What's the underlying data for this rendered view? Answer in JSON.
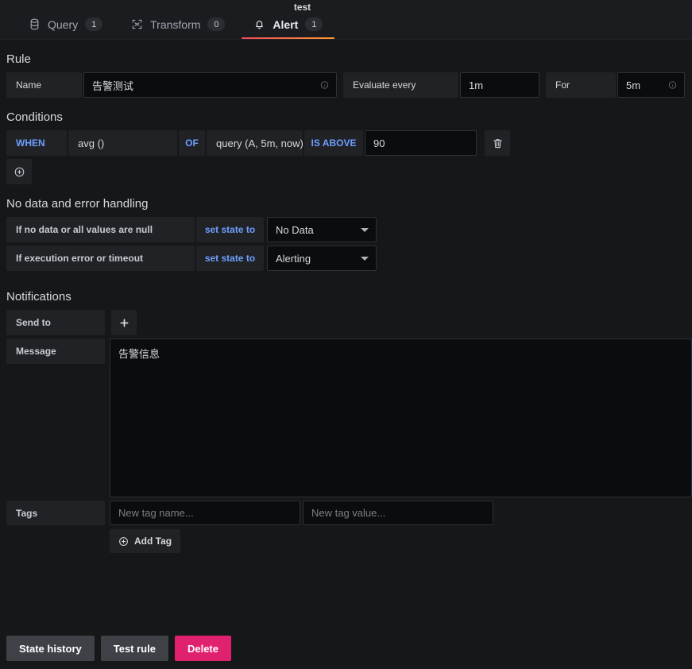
{
  "header": {
    "title": "test",
    "tabs": [
      {
        "label": "Query",
        "badge": "1",
        "icon": "database-icon",
        "active": false
      },
      {
        "label": "Transform",
        "badge": "0",
        "icon": "transform-icon",
        "active": false
      },
      {
        "label": "Alert",
        "badge": "1",
        "icon": "bell-icon",
        "active": true
      }
    ],
    "accent_color": "#ff9830"
  },
  "rule": {
    "section_label": "Rule",
    "name_label": "Name",
    "name_value": "告警测试",
    "evaluate_every_label": "Evaluate every",
    "evaluate_every_value": "1m",
    "for_label": "For",
    "for_value": "5m"
  },
  "conditions": {
    "section_label": "Conditions",
    "rows": [
      {
        "when_label": "WHEN",
        "reducer": "avg ()",
        "of_label": "OF",
        "query": "query (A, 5m, now)",
        "evaluator": "IS ABOVE",
        "threshold": "90",
        "delete_icon": "trash-icon"
      }
    ],
    "add_icon": "circle-plus-icon"
  },
  "no_data_handling": {
    "section_label": "No data and error handling",
    "rows": [
      {
        "condition_label": "If no data or all values are null",
        "set_state_label": "set state to",
        "state_value": "No Data"
      },
      {
        "condition_label": "If execution error or timeout",
        "set_state_label": "set state to",
        "state_value": "Alerting"
      }
    ]
  },
  "notifications": {
    "section_label": "Notifications",
    "send_to_label": "Send to",
    "add_receiver_icon": "plus-icon",
    "message_label": "Message",
    "message_value": "告警信息",
    "tags_label": "Tags",
    "tag_name_placeholder": "New tag name...",
    "tag_value_placeholder": "New tag value...",
    "tag_name_value": "",
    "tag_value_value": "",
    "add_tag_label": "Add Tag",
    "add_tag_icon": "circle-plus-icon"
  },
  "footer": {
    "state_history_label": "State history",
    "test_rule_label": "Test rule",
    "delete_label": "Delete",
    "delete_color": "#e0226e"
  }
}
